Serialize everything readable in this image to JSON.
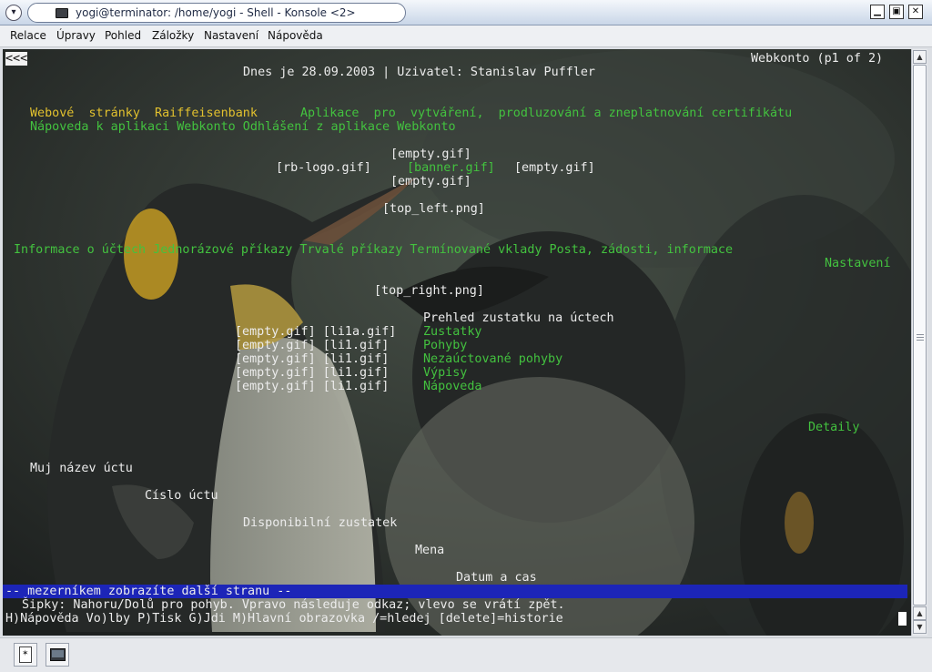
{
  "window": {
    "title": "yogi@terminator: /home/yogi - Shell - Konsole <2>"
  },
  "menubar": [
    "Relace",
    "Úpravy",
    "Pohled",
    "Záložky",
    "Nastavení",
    "Nápověda"
  ],
  "terminal": {
    "back_link": "<<<",
    "page_indicator": "Webkonto (p1 of 2)",
    "header_line": "Dnes je 28.09.2003 | Uzivatel: Stanislav Puffler",
    "nav_yellow": "Webové  stránky  Raiffeisenbank",
    "nav_green": "Aplikace  pro  vytváření,  prodluzování a zneplatnování certifikátu",
    "help_links": "Nápoveda k aplikaci Webkonto Odhlášení z aplikace Webkonto",
    "img_empty_1": "[empty.gif]",
    "img_rb_logo": "[rb-logo.gif]",
    "img_banner": "[banner.gif]",
    "img_empty_2": "[empty.gif]",
    "img_empty_3": "[empty.gif]",
    "img_top_left": "[top_left.png]",
    "menu_links": "Informace o účtech Jednorázové příkazy Trvalé příkazy Termínované vklady Posta, zádosti, informace",
    "nastaveni": "Nastavení",
    "img_top_right": "[top_right.png]",
    "overview_heading": "Prehled zustatku na úctech",
    "overview_rows": [
      {
        "imgs": "[empty.gif] [li1a.gif]",
        "link": "Zustatky"
      },
      {
        "imgs": "[empty.gif] [li1.gif]",
        "link": "Pohyby"
      },
      {
        "imgs": "[empty.gif] [li1.gif]",
        "link": "Nezaúctované pohyby"
      },
      {
        "imgs": "[empty.gif] [li1.gif]",
        "link": "Výpisy"
      },
      {
        "imgs": "[empty.gif] [li1.gif]",
        "link": "Nápoveda"
      }
    ],
    "detaily": "Detaily",
    "col_account_name": "Muj název úctu",
    "col_account_number": "Císlo úctu",
    "col_balance": "Disponibilní zustatek",
    "col_currency": "Mena",
    "col_datetime": "Datum a cas",
    "status_line": "-- mezerníkem zobrazíte další stranu --",
    "hint_line": "Šipky: Nahoru/Dolů pro pohyb. Vpravo následuje odkaz; vlevo se vrátí zpět.",
    "command_line": "H)Nápověda Vo)lby P)Tisk G)Jdi M)Hlavní obrazovka /=hledej [delete]=historie"
  },
  "colors": {
    "link_green": "#43c23f",
    "link_yellow": "#e2c12e",
    "status_blue": "#1c25b8",
    "terminal_bg": "#2d302e"
  },
  "icons": {
    "window_menu": "chevron-down-icon",
    "title_app": "terminal-icon",
    "minimize": "minimize-icon",
    "maximize": "maximize-icon",
    "close": "close-icon",
    "new_session": "new-session-icon",
    "session_tab": "terminal-icon"
  }
}
